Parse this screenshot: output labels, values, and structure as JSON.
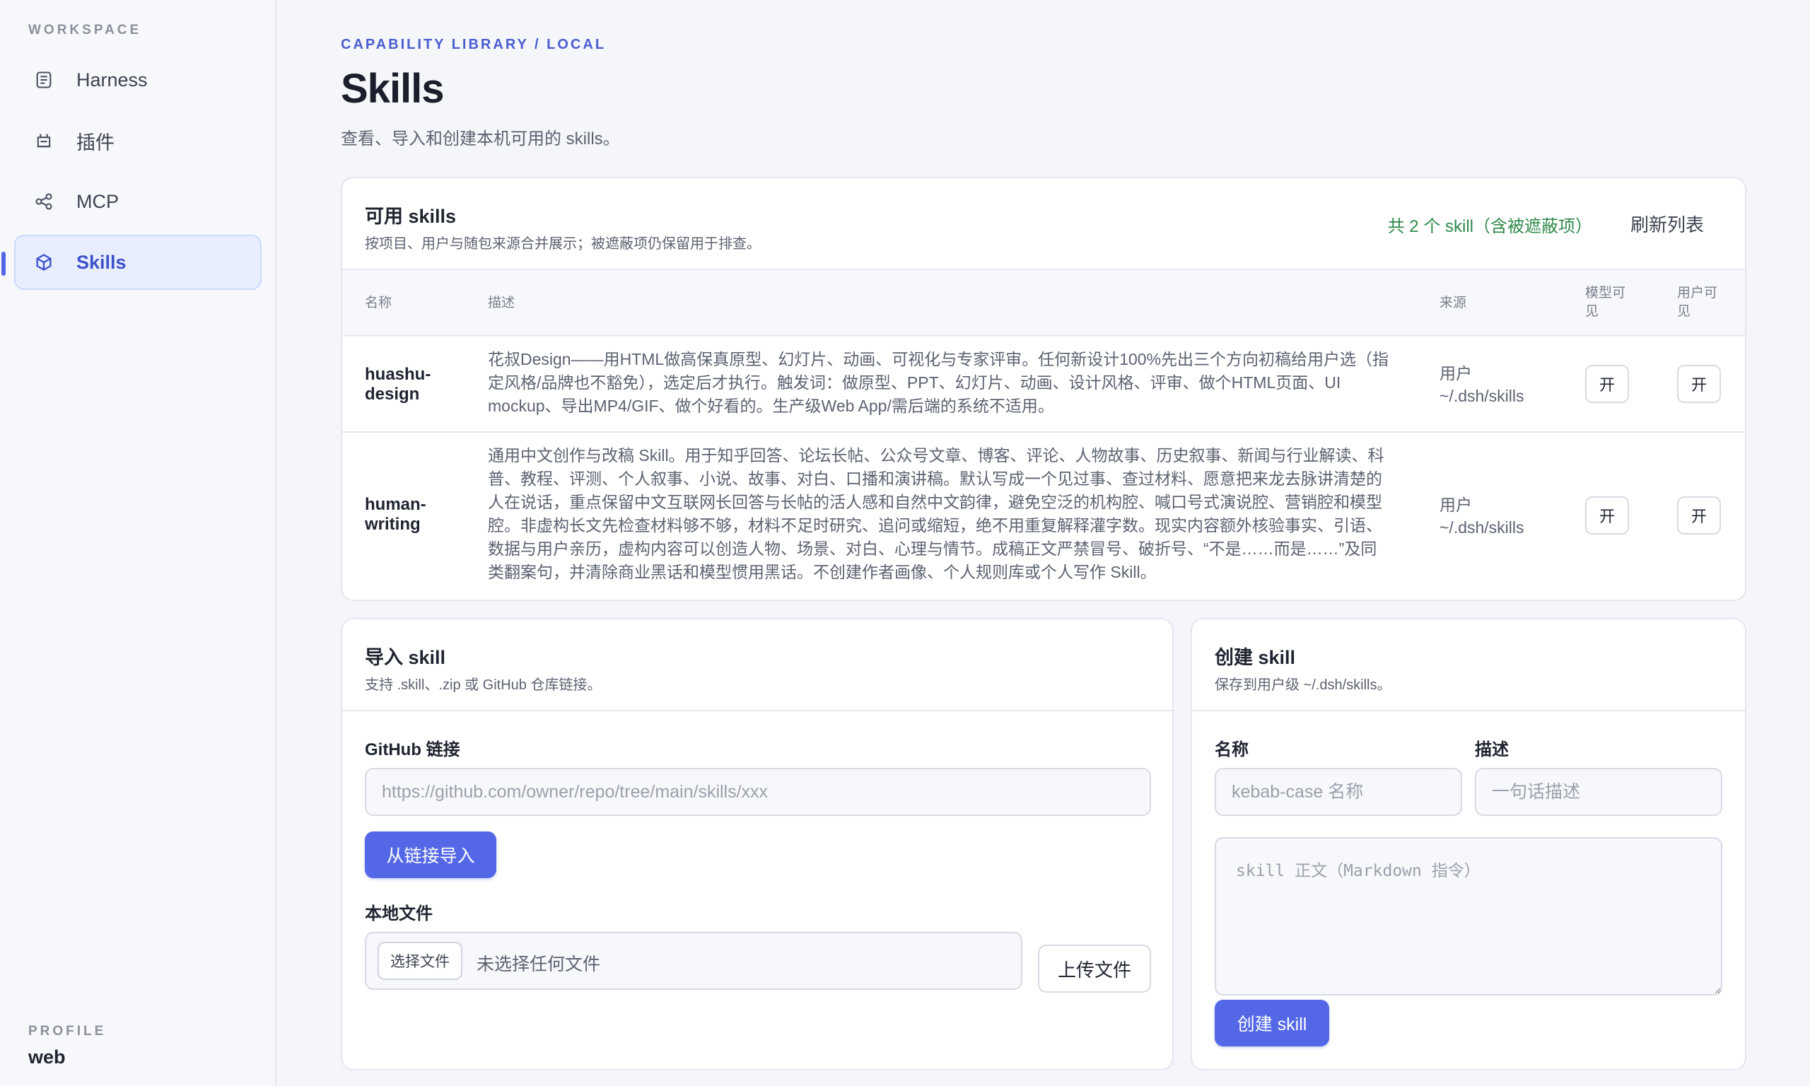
{
  "sidebar": {
    "section_label": "WORKSPACE",
    "items": [
      {
        "label": "Harness",
        "icon": "document-icon"
      },
      {
        "label": "插件",
        "icon": "plugin-icon"
      },
      {
        "label": "MCP",
        "icon": "share-nodes-icon"
      },
      {
        "label": "Skills",
        "icon": "cube-icon",
        "active": true
      }
    ],
    "profile_label": "PROFILE",
    "profile_value": "web"
  },
  "header": {
    "breadcrumb": "CAPABILITY LIBRARY / LOCAL",
    "title": "Skills",
    "subtitle": "查看、导入和创建本机可用的 skills。"
  },
  "skills_card": {
    "title": "可用 skills",
    "subtitle": "按项目、用户与随包来源合并展示；被遮蔽项仍保留用于排查。",
    "count": "共 2 个 skill（含被遮蔽项）",
    "refresh_label": "刷新列表",
    "columns": {
      "name": "名称",
      "desc": "描述",
      "source": "来源",
      "model_visible_1": "模型可",
      "model_visible_2": "见",
      "user_visible_1": "用户可",
      "user_visible_2": "见"
    },
    "rows": [
      {
        "name_1": "huashu-",
        "name_2": "design",
        "desc": "花叔Design——用HTML做高保真原型、幻灯片、动画、可视化与专家评审。任何新设计100%先出三个方向初稿给用户选（指定风格/品牌也不豁免），选定后才执行。触发词：做原型、PPT、幻灯片、动画、设计风格、评审、做个HTML页面、UI mockup、导出MP4/GIF、做个好看的。生产级Web App/需后端的系统不适用。",
        "source_1": "用户",
        "source_2": "~/.dsh/skills",
        "model_toggle": "开",
        "user_toggle": "开"
      },
      {
        "name_1": "human-",
        "name_2": "writing",
        "desc": "通用中文创作与改稿 Skill。用于知乎回答、论坛长帖、公众号文章、博客、评论、人物故事、历史叙事、新闻与行业解读、科普、教程、评测、个人叙事、小说、故事、对白、口播和演讲稿。默认写成一个见过事、查过材料、愿意把来龙去脉讲清楚的人在说话，重点保留中文互联网长回答与长帖的活人感和自然中文韵律，避免空泛的机构腔、喊口号式演说腔、营销腔和模型腔。非虚构长文先检查材料够不够，材料不足时研究、追问或缩短，绝不用重复解释灌字数。现实内容额外核验事实、引语、数据与用户亲历，虚构内容可以创造人物、场景、对白、心理与情节。成稿正文严禁冒号、破折号、“不是……而是……”及同类翻案句，并清除商业黑话和模型惯用黑话。不创建作者画像、个人规则库或个人写作 Skill。",
        "source_1": "用户",
        "source_2": "~/.dsh/skills",
        "model_toggle": "开",
        "user_toggle": "开"
      }
    ]
  },
  "import_card": {
    "title": "导入 skill",
    "subtitle": "支持 .skill、.zip 或 GitHub 仓库链接。",
    "github_label": "GitHub 链接",
    "github_placeholder": "https://github.com/owner/repo/tree/main/skills/xxx",
    "import_button": "从链接导入",
    "local_label": "本地文件",
    "choose_file": "选择文件",
    "no_file": "未选择任何文件",
    "upload_button": "上传文件"
  },
  "create_card": {
    "title": "创建 skill",
    "subtitle": "保存到用户级 ~/.dsh/skills。",
    "name_label": "名称",
    "name_placeholder": "kebab-case 名称",
    "desc_label": "描述",
    "desc_placeholder": "一句话描述",
    "body_placeholder": "skill 正文（Markdown 指令）",
    "create_button": "创建 skill"
  },
  "colors": {
    "accent": "#5468e7",
    "accent_text": "#4a5ccf",
    "count_green": "#2f8a4a",
    "background": "#f4f6f9"
  }
}
